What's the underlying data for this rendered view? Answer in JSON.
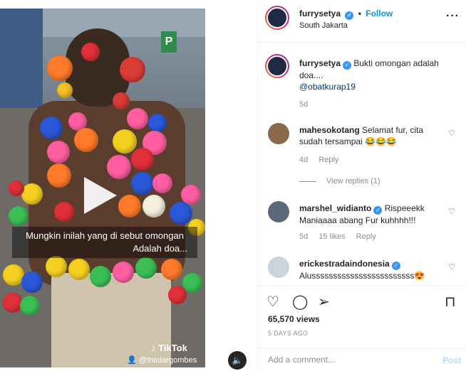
{
  "header": {
    "username": "furrysetya",
    "follow_label": "Follow",
    "location": "South Jakarta",
    "more_icon": "more-options-icon"
  },
  "video": {
    "caption_line1": "Mungkin inilah yang di sebut omongan",
    "caption_line2": "Adalah doa...",
    "tiktok_label": "TikTok",
    "tiktok_user": "@thedargombes",
    "sign_letter": "P"
  },
  "caption_comment": {
    "username": "furrysetya",
    "text": "Bukti omongan adalah doa....",
    "mention": "@obatkurap19",
    "age": "5d"
  },
  "comments": [
    {
      "username": "mahesokotang",
      "text": "Selamat fur, cita sudah tersampai 😂😂😂",
      "age": "4d",
      "reply_label": "Reply",
      "view_replies": "View replies (1)"
    },
    {
      "username": "marshel_widianto",
      "text": "Rispeeekk Maniaaaa abang Fur kuhhhh!!!",
      "age": "5d",
      "likes": "15 likes",
      "reply_label": "Reply"
    },
    {
      "username": "erickestradaindonesia",
      "text": "Alussssssssssssssssssssssss😍"
    }
  ],
  "stats": {
    "views": "65,570 views",
    "date": "5 DAYS AGO"
  },
  "add_comment": {
    "placeholder": "Add a comment...",
    "post_label": "Post"
  },
  "colors": {
    "accent": "#0095f6",
    "verified": "#3897f0",
    "muted": "#8e8e8e"
  }
}
